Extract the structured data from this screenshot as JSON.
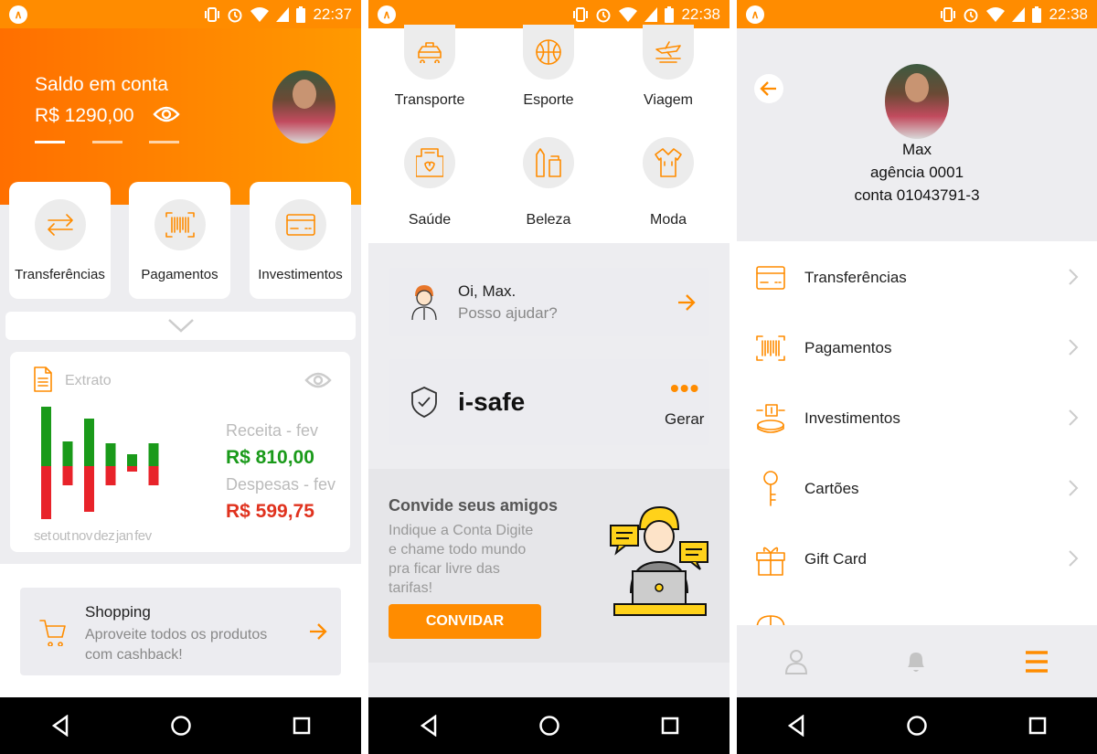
{
  "status": {
    "p1_time": "22:37",
    "p2_time": "22:38",
    "p3_time": "22:38"
  },
  "p1": {
    "balance_label": "Saldo em conta",
    "balance_value": "R$ 1290,00",
    "actions": [
      {
        "label": "Transferências",
        "icon": "transfer-icon"
      },
      {
        "label": "Pagamentos",
        "icon": "barcode-icon"
      },
      {
        "label": "Investimentos",
        "icon": "card-icon"
      }
    ],
    "extrato": {
      "title": "Extrato",
      "months": "set out nov dez jan fev",
      "receita_label": "Receita - fev",
      "receita_value": "R$ 810,00",
      "despesas_label": "Despesas - fev",
      "despesas_value": "R$ 599,75",
      "colors": {
        "receita": "#1a9a1a",
        "despesas": "#e8232a"
      }
    },
    "shopping": {
      "title": "Shopping",
      "text": "Aproveite todos os produtos com cashback!"
    }
  },
  "chart_data": {
    "type": "bar",
    "categories": [
      "set",
      "out",
      "nov",
      "dez",
      "jan",
      "fev"
    ],
    "series": [
      {
        "name": "Receita",
        "values": [
          65,
          27,
          52,
          25,
          13,
          25
        ]
      },
      {
        "name": "Despesas",
        "values": [
          58,
          21,
          50,
          21,
          6,
          21
        ]
      }
    ]
  },
  "p2": {
    "categories": [
      {
        "label": "Transporte",
        "icon": "taxi-icon"
      },
      {
        "label": "Esporte",
        "icon": "basketball-icon"
      },
      {
        "label": "Viagem",
        "icon": "plane-icon"
      },
      {
        "label": "Saúde",
        "icon": "health-icon"
      },
      {
        "label": "Beleza",
        "icon": "cosmetics-icon"
      },
      {
        "label": "Moda",
        "icon": "shirt-icon"
      }
    ],
    "assistant": {
      "greeting": "Oi, Max.",
      "question": "Posso ajudar?"
    },
    "isafe": {
      "title": "i-safe",
      "action": "Gerar"
    },
    "invite": {
      "title": "Convide seus amigos",
      "text": "Indique a Conta Digite e chame todo mundo pra ficar livre das tarifas!",
      "button": "CONVIDAR"
    }
  },
  "p3": {
    "name": "Max",
    "agency": "agência 0001",
    "account": "conta 01043791-3",
    "menu": [
      {
        "label": "Transferências",
        "icon": "card-icon"
      },
      {
        "label": "Pagamentos",
        "icon": "barcode-icon"
      },
      {
        "label": "Investimentos",
        "icon": "coins-icon"
      },
      {
        "label": "Cartões",
        "icon": "key-icon"
      },
      {
        "label": "Gift Card",
        "icon": "gift-icon"
      }
    ],
    "tabs": [
      "profile-icon",
      "bell-icon",
      "menu-icon"
    ]
  },
  "accent": "#ff8c00"
}
